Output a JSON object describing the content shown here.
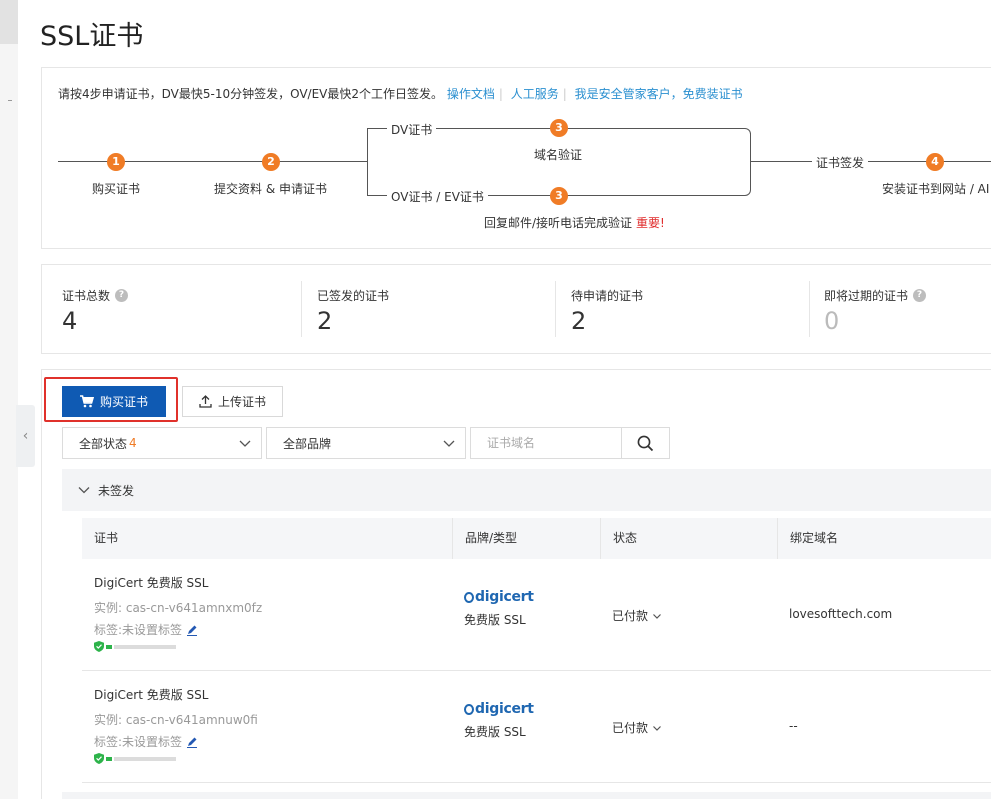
{
  "page": {
    "title": "SSL证书"
  },
  "process": {
    "intro": "请按4步申请证书，DV最快5-10分钟签发，OV/EV最快2个工作日签发。",
    "links": [
      "操作文档",
      "人工服务",
      "我是安全管家客户，免费装证书"
    ],
    "steps": [
      {
        "num": "1",
        "label": "购买证书"
      },
      {
        "num": "2",
        "label": "提交资料 & 申请证书"
      },
      {
        "num": "3",
        "label": "域名验证"
      },
      {
        "num": "3",
        "label": "回复邮件/接听电话完成验证"
      },
      {
        "num": "4",
        "label": "安装证书到网站 / AI"
      }
    ],
    "dv_label": "DV证书",
    "ovev_label": "OV证书 / EV证书",
    "issue_label": "证书签发",
    "important": "重要!"
  },
  "stats": [
    {
      "label": "证书总数",
      "value": "4",
      "help": true
    },
    {
      "label": "已签发的证书",
      "value": "2",
      "help": false
    },
    {
      "label": "待申请的证书",
      "value": "2",
      "help": false
    },
    {
      "label": "即将过期的证书",
      "value": "0",
      "help": true
    }
  ],
  "toolbar": {
    "buy_label": "购买证书",
    "upload_label": "上传证书"
  },
  "filters": {
    "status_label": "全部状态",
    "status_count": "4",
    "brand_label": "全部品牌",
    "search_placeholder": "证书域名"
  },
  "group": {
    "label": "未签发"
  },
  "table": {
    "headers": [
      "证书",
      "品牌/类型",
      "状态",
      "绑定域名"
    ],
    "rows": [
      {
        "name": "DigiCert 免费版 SSL",
        "instance": "实例: cas-cn-v641amnxm0fz",
        "tag": "标签:未设置标签",
        "brand": "digicert",
        "type": "免费版 SSL",
        "status": "已付款",
        "domain": "lovesofttech.com"
      },
      {
        "name": "DigiCert 免费版 SSL",
        "instance": "实例: cas-cn-v641amnuw0fi",
        "tag": "标签:未设置标签",
        "brand": "digicert",
        "type": "免费版 SSL",
        "status": "已付款",
        "domain": "--"
      }
    ]
  },
  "colors": {
    "accent": "#0f5ab3",
    "step": "#f07c26",
    "link": "#2a8fd0",
    "highlight": "#e0312b"
  }
}
